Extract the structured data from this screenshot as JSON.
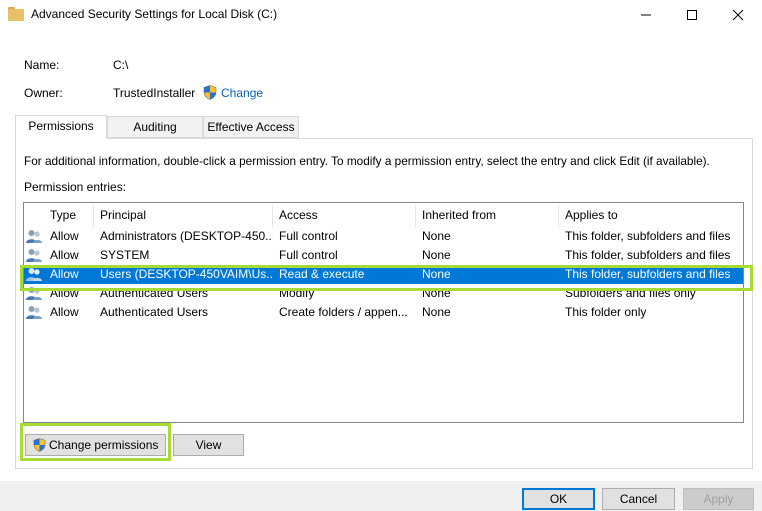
{
  "window": {
    "title": "Advanced Security Settings for Local Disk (C:)",
    "controls": [
      "minimize-icon",
      "maximize-icon",
      "close-icon"
    ]
  },
  "info": {
    "name_label": "Name:",
    "name_value": "C:\\",
    "owner_label": "Owner:",
    "owner_value": "TrustedInstaller",
    "change_link": "Change"
  },
  "tabs": [
    {
      "label": "Permissions",
      "active": true
    },
    {
      "label": "Auditing",
      "active": false
    },
    {
      "label": "Effective Access",
      "active": false
    }
  ],
  "instructions": "For additional information, double-click a permission entry. To modify a permission entry, select the entry and click Edit (if available).",
  "entries_label": "Permission entries:",
  "table": {
    "columns": [
      "Type",
      "Principal",
      "Access",
      "Inherited from",
      "Applies to"
    ],
    "rows": [
      {
        "type": "Allow",
        "principal": "Administrators (DESKTOP-450...",
        "access": "Full control",
        "inherited": "None",
        "applies": "This folder, subfolders and files",
        "selected": false
      },
      {
        "type": "Allow",
        "principal": "SYSTEM",
        "access": "Full control",
        "inherited": "None",
        "applies": "This folder, subfolders and files",
        "selected": false
      },
      {
        "type": "Allow",
        "principal": "Users (DESKTOP-450VAIM\\Us...",
        "access": "Read & execute",
        "inherited": "None",
        "applies": "This folder, subfolders and files",
        "selected": true
      },
      {
        "type": "Allow",
        "principal": "Authenticated Users",
        "access": "Modify",
        "inherited": "None",
        "applies": "Subfolders and files only",
        "selected": false
      },
      {
        "type": "Allow",
        "principal": "Authenticated Users",
        "access": "Create folders / appen...",
        "inherited": "None",
        "applies": "This folder only",
        "selected": false
      }
    ]
  },
  "buttons": {
    "change_permissions": "Change permissions",
    "view": "View",
    "ok": "OK",
    "cancel": "Cancel",
    "apply": "Apply"
  },
  "colors": {
    "selection": "#0078d7",
    "highlight": "#a8d934",
    "link": "#0a5fb4"
  }
}
